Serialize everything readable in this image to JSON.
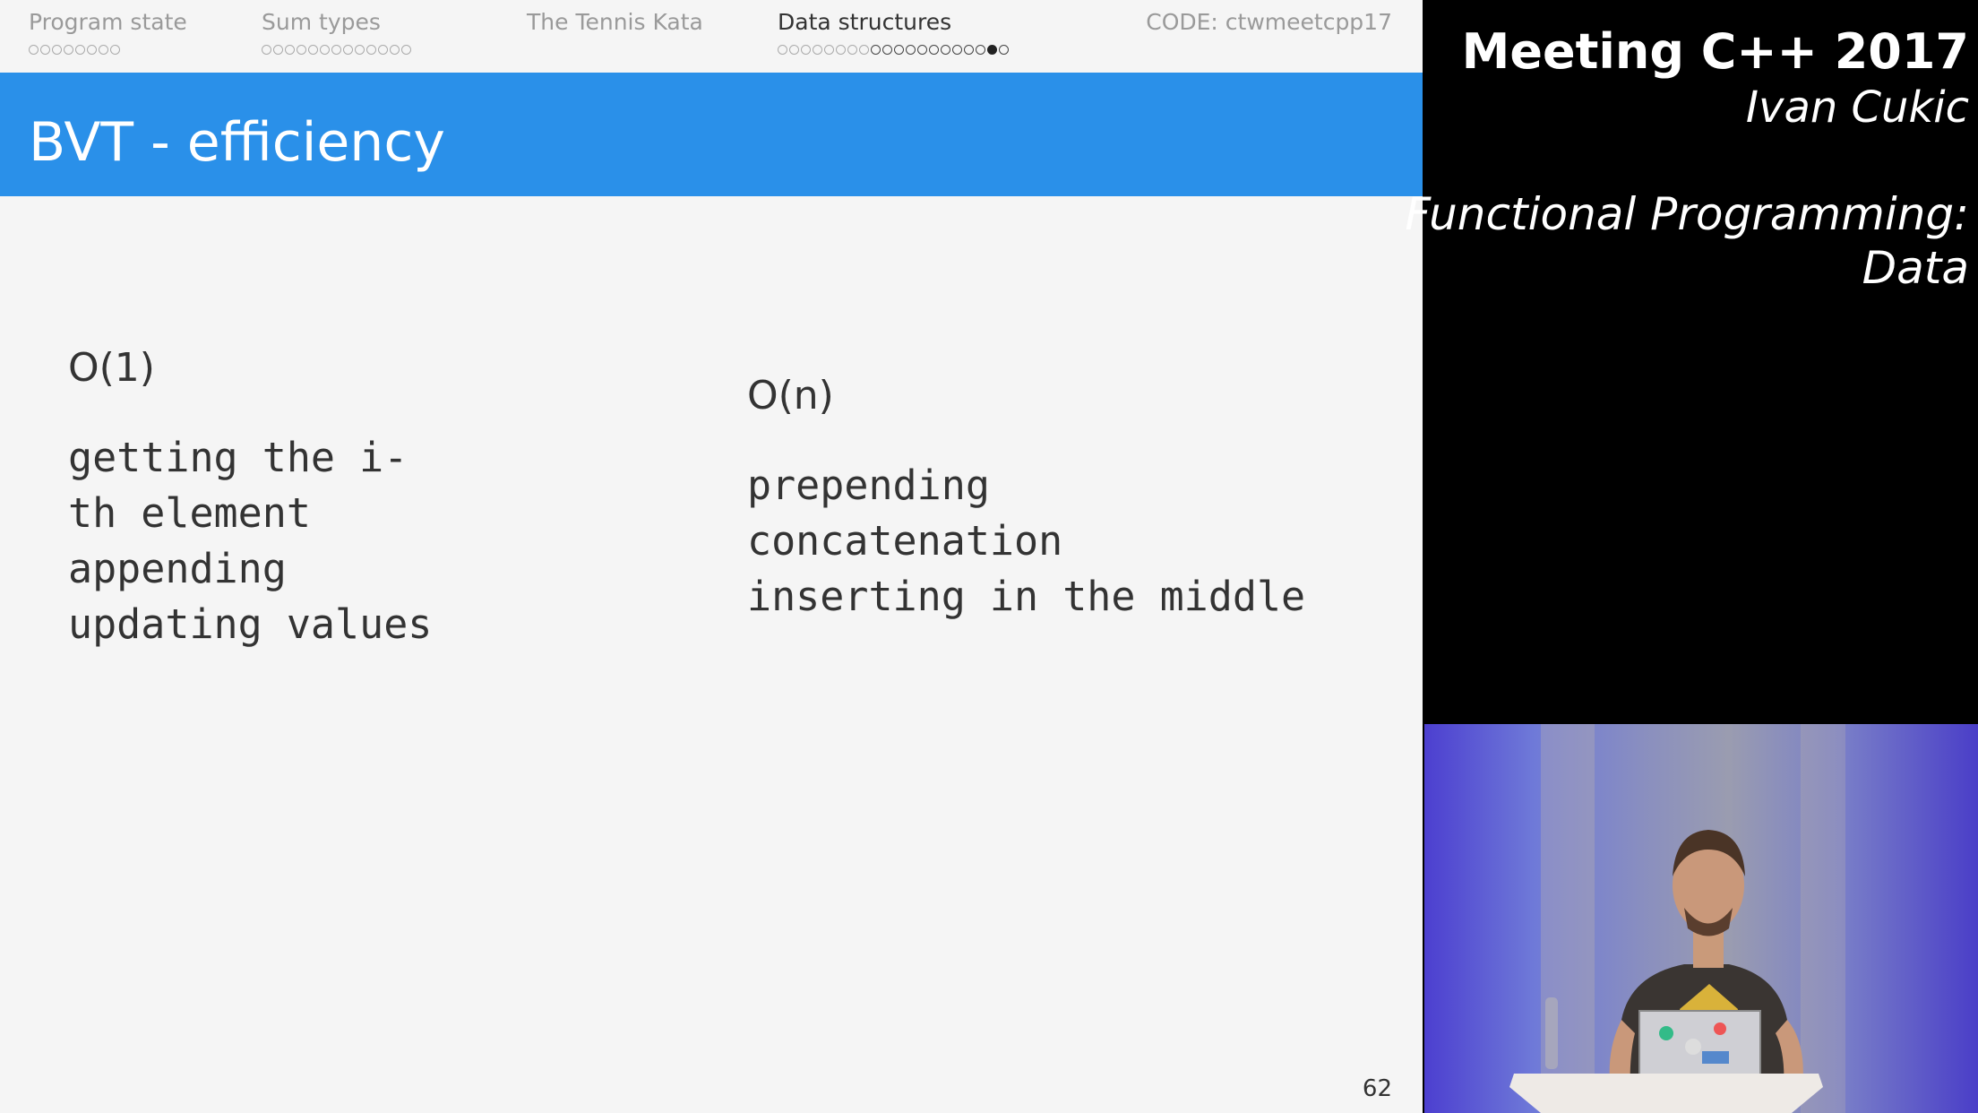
{
  "nav": {
    "sections": [
      {
        "label": "Program state",
        "dot_count": 8,
        "state": "past"
      },
      {
        "label": "Sum types",
        "dot_count": 13,
        "state": "past"
      },
      {
        "label": "The Tennis Kata",
        "dot_count": 0,
        "state": "past"
      },
      {
        "label": "Data structures",
        "dot_count": 20,
        "seen_from": 8,
        "current_index": 18,
        "state": "active"
      }
    ],
    "code": "CODE: ctwmeetcpp17"
  },
  "slide": {
    "title": "BVT - efficiency",
    "left": {
      "heading": "O(1)",
      "items": [
        "getting the i-",
        "th element",
        "appending",
        "updating values"
      ]
    },
    "right": {
      "heading": "O(n)",
      "items": [
        "prepending",
        "concatenation",
        "inserting in the middle"
      ]
    },
    "page_number": "62"
  },
  "overlay": {
    "conference": "Meeting C++ 2017",
    "speaker": "Ivan Cukic",
    "talk_line1": "Functional Programming:",
    "talk_line2": "Data"
  },
  "colors": {
    "title_bar": "#2a90e9",
    "slide_bg": "#f5f5f5",
    "overlay_bg": "#000000"
  }
}
